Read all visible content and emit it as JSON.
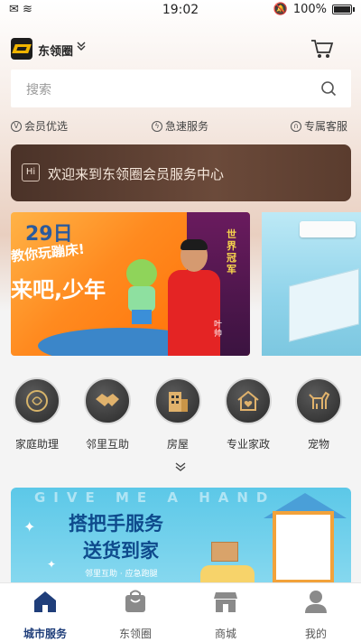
{
  "status_bar": {
    "time": "19:02",
    "battery": "100%"
  },
  "header": {
    "city": "东领圈"
  },
  "search": {
    "placeholder": "搜索"
  },
  "features": [
    {
      "icon": "v-badge-icon",
      "label": "会员优选"
    },
    {
      "icon": "lightning-icon",
      "label": "急速服务"
    },
    {
      "icon": "headset-icon",
      "label": "专属客服"
    }
  ],
  "welcome": {
    "badge": "Hi",
    "text": "欢迎来到东领圈会员服务中心"
  },
  "banner": {
    "date": "29日",
    "line1": "教你玩蹦床!",
    "line2": "来吧,少年",
    "vertical": "世界冠军",
    "vertical2": "叶帅"
  },
  "categories": [
    {
      "icon": "family-assistant-icon",
      "label": "家庭助理"
    },
    {
      "icon": "handshake-icon",
      "label": "邻里互助"
    },
    {
      "icon": "building-icon",
      "label": "房屋"
    },
    {
      "icon": "house-heart-icon",
      "label": "专业家政"
    },
    {
      "icon": "dog-icon",
      "label": "宠物"
    }
  ],
  "promo": {
    "watermark": "GIVE ME A HAND",
    "line1": "搭把手服务",
    "line2": "送货到家",
    "line3": "邻里互助 · 应急跑腿"
  },
  "tabs": [
    {
      "icon": "home-icon",
      "label": "城市服务",
      "active": true
    },
    {
      "icon": "bag-icon",
      "label": "东领圈",
      "active": false
    },
    {
      "icon": "store-icon",
      "label": "商城",
      "active": false
    },
    {
      "icon": "user-icon",
      "label": "我的",
      "active": false
    }
  ],
  "colors": {
    "accent": "#1f3e7a",
    "welcome_bg": "#4a3228",
    "welcome_text": "#f6e8dc"
  }
}
